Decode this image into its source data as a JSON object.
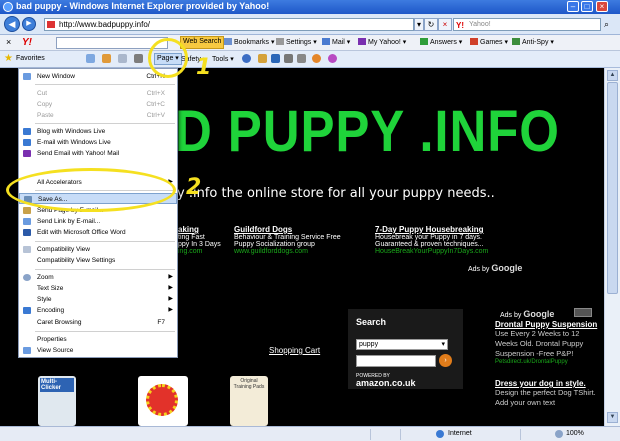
{
  "window": {
    "title": "bad puppy - Windows Internet Explorer provided by Yahoo!"
  },
  "address": {
    "url": "http://www.badpuppy.info/"
  },
  "search": {
    "placeholder": "Yahoo!"
  },
  "yahoo_toolbar": {
    "logo": "Y!",
    "web_search": "Web Search",
    "items": [
      {
        "label": "Bookmarks",
        "icon": "bookmarks-icon"
      },
      {
        "label": "Settings",
        "icon": "settings-icon"
      },
      {
        "label": "Mail",
        "icon": "mail-icon"
      },
      {
        "label": "My Yahoo!",
        "icon": "my-yahoo-icon"
      },
      {
        "label": "Answers",
        "icon": "answers-icon"
      },
      {
        "label": "Games",
        "icon": "games-icon"
      },
      {
        "label": "Anti-Spy",
        "icon": "anti-spy-icon"
      }
    ]
  },
  "command_bar": {
    "favorites": "Favorites",
    "page": "Page",
    "safety": "Safety",
    "tools": "Tools"
  },
  "page_menu": {
    "items": [
      {
        "label": "New Window",
        "shortcut": "Ctrl+N",
        "disabled": false
      },
      {
        "label": "Cut",
        "shortcut": "Ctrl+X",
        "disabled": true
      },
      {
        "label": "Copy",
        "shortcut": "Ctrl+C",
        "disabled": true
      },
      {
        "label": "Paste",
        "shortcut": "Ctrl+V",
        "disabled": true
      },
      {
        "label": "Blog with Windows Live",
        "shortcut": "",
        "disabled": false
      },
      {
        "label": "E-mail with Windows Live",
        "shortcut": "",
        "disabled": false
      },
      {
        "label": "Send Email with Yahoo! Mail",
        "shortcut": "",
        "disabled": false
      },
      {
        "label": "All Accelerators",
        "shortcut": "",
        "disabled": false
      },
      {
        "label": "Save As...",
        "shortcut": "",
        "disabled": false
      },
      {
        "label": "Send Page by E-mail...",
        "shortcut": "",
        "disabled": false
      },
      {
        "label": "Send Link by E-mail...",
        "shortcut": "",
        "disabled": false
      },
      {
        "label": "Edit with Microsoft Office Word",
        "shortcut": "",
        "disabled": false
      },
      {
        "label": "Compatibility View",
        "shortcut": "",
        "disabled": false
      },
      {
        "label": "Compatibility View Settings",
        "shortcut": "",
        "disabled": false
      },
      {
        "label": "Zoom",
        "shortcut": "",
        "disabled": false
      },
      {
        "label": "Text Size",
        "shortcut": "",
        "disabled": false
      },
      {
        "label": "Style",
        "shortcut": "",
        "disabled": false
      },
      {
        "label": "Encoding",
        "shortcut": "",
        "disabled": false
      },
      {
        "label": "Caret Browsing",
        "shortcut": "F7",
        "disabled": false
      },
      {
        "label": "Properties",
        "shortcut": "",
        "disabled": false
      },
      {
        "label": "View Source",
        "shortcut": "",
        "disabled": false
      }
    ]
  },
  "annotations": {
    "one": "1",
    "two": "2"
  },
  "webpage": {
    "banner": "D PUPPY .INFO",
    "tagline": "y .info the online store for all your puppy needs..",
    "ads": [
      {
        "title": "aking",
        "line1": "ting Fast",
        "line2": "ppy In 3 Days",
        "url": "ing.com"
      },
      {
        "title": "Guildford Dogs",
        "line1": "Behaviour & Training Service Free",
        "line2": "Puppy Socialization group",
        "url": "www.guildforddogs.com"
      },
      {
        "title": "7-Day Puppy Housebreaking",
        "line1": "Housebreak your Puppy in 7 days.",
        "line2": "Guaranteed & proven techniques...",
        "url": "HouseBreakYourPuppyIn7Days.com"
      }
    ],
    "ads_by": "Ads by",
    "google": "Google",
    "shopping_cart": "Shopping Cart",
    "search_box": {
      "label": "Search",
      "selected": "puppy",
      "powered": "POWERED BY",
      "amazon": "amazon.co.uk"
    },
    "right_ads": {
      "ads_by": "Ads by",
      "google": "Google",
      "ad1_title": "Drontal Puppy Suspension",
      "ad1_body": "Use Every 2 Weeks to 12 Weeks Old. Drontal Puppy Suspension -Free P&P!",
      "ad1_url": "Petsdirect.uk/DrontalPuppy",
      "ad2_title": "Dress your dog in style.",
      "ad2_body": "Design the perfect Dog TShirt. Add your own text"
    },
    "products": [
      "Multi-Clicker",
      "ball",
      "Original Training Pads"
    ]
  },
  "status": {
    "zone": "Internet",
    "zoom": "100%"
  }
}
